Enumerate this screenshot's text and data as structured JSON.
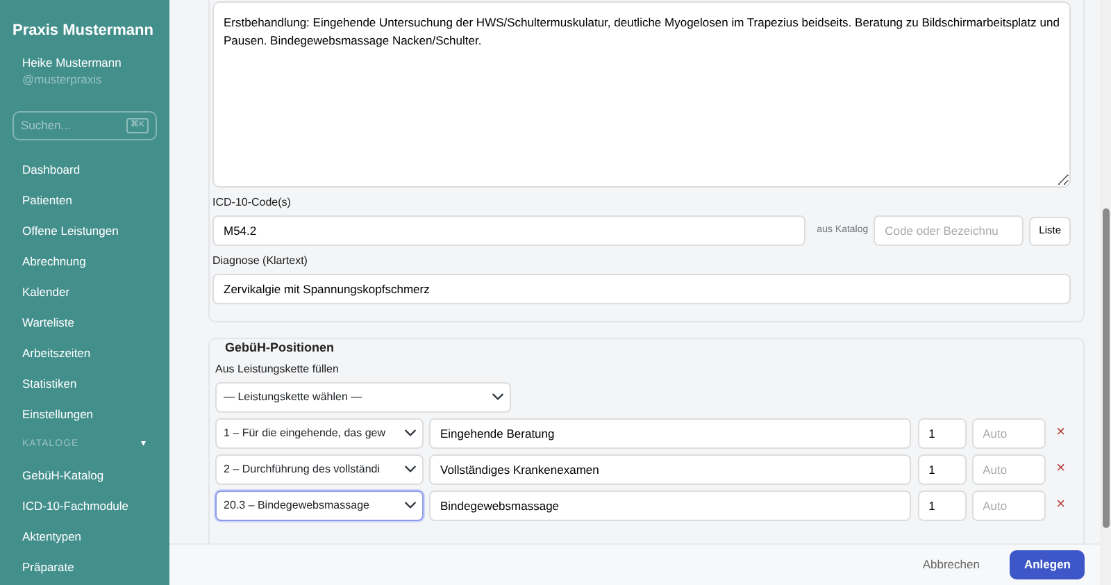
{
  "sidebar": {
    "title": "Praxis Mustermann",
    "user_name": "Heike Mustermann",
    "user_handle": "@musterpraxis",
    "search": {
      "placeholder": "Suchen...",
      "shortcut": "⌘K"
    },
    "items": [
      {
        "label": "Dashboard"
      },
      {
        "label": "Patienten"
      },
      {
        "label": "Offene Leistungen"
      },
      {
        "label": "Abrechnung"
      },
      {
        "label": "Kalender"
      },
      {
        "label": "Warteliste"
      },
      {
        "label": "Arbeitszeiten"
      },
      {
        "label": "Statistiken"
      },
      {
        "label": "Einstellungen"
      }
    ],
    "section": {
      "label": "KATALOGE",
      "caret": "▾",
      "expanded": true,
      "items": [
        {
          "label": "GebüH-Katalog"
        },
        {
          "label": "ICD-10-Fachmodule"
        },
        {
          "label": "Aktentypen"
        },
        {
          "label": "Präparate"
        }
      ]
    }
  },
  "findings": {
    "value": "Erstbehandlung: Eingehende Untersuchung der HWS/Schultermuskulatur, deutliche Myogelosen im Trapezius beidseits. Beratung zu Bildschirmarbeitsplatz und Pausen. Bindegewebsmassage Nacken/Schulter.",
    "icd_label": "ICD-10-Code(s)",
    "icd_value": "M54.2",
    "catalog_label": "aus Katalog",
    "catalog_placeholder": "Code oder Bezeichnu",
    "list_button": "Liste",
    "diagnosis_label": "Diagnose (Klartext)",
    "diagnosis_value": "Zervikalgie mit Spannungskopfschmerz"
  },
  "positions": {
    "legend": "GebüH-Positionen",
    "chain_label": "Aus Leistungskette füllen",
    "chain_select": "— Leistungskette wählen —",
    "rows": [
      {
        "code": "1 – Für die eingehende, das gew",
        "text": "Eingehende Beratung",
        "quantity": "1",
        "price_placeholder": "Auto",
        "remove": "×",
        "focused": false
      },
      {
        "code": "2 – Durchführung des vollständi",
        "text": "Vollständiges Krankenexamen",
        "quantity": "1",
        "price_placeholder": "Auto",
        "remove": "×",
        "focused": false
      },
      {
        "code": "20.3 – Bindegewebsmassage",
        "text": "Bindegewebsmassage",
        "quantity": "1",
        "price_placeholder": "Auto",
        "remove": "×",
        "focused": true
      }
    ]
  },
  "footer": {
    "cancel": "Abbrechen",
    "submit": "Anlegen"
  }
}
